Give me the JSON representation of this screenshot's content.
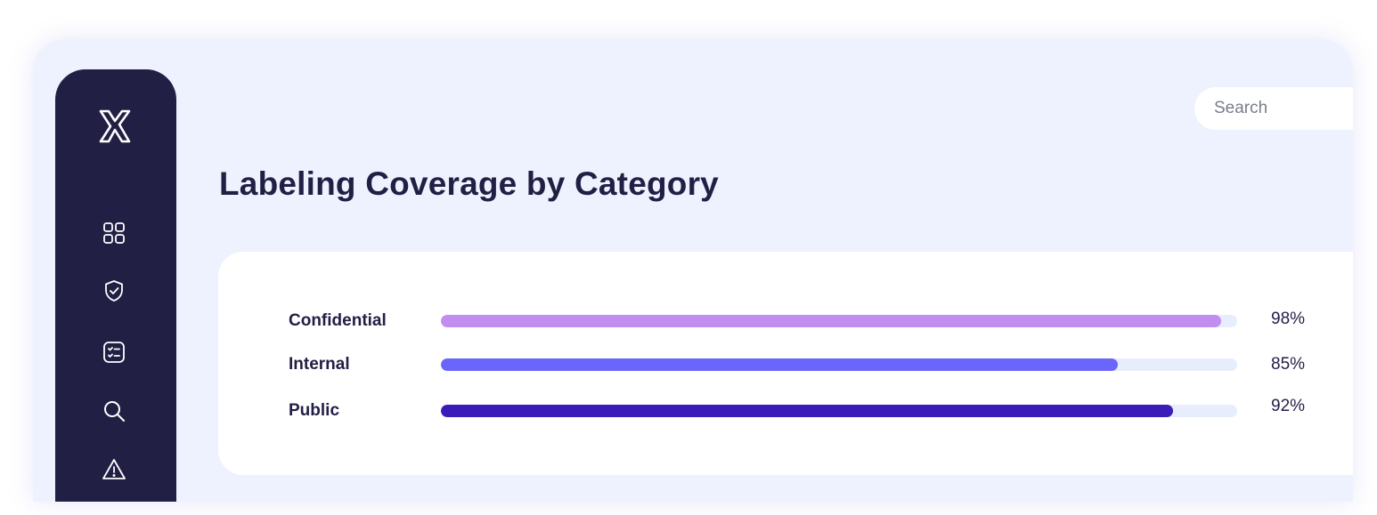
{
  "header": {
    "title": "Labeling Coverage by Category",
    "search": {
      "placeholder": "Search",
      "value": ""
    }
  },
  "sidebar": {
    "logo": "k-logo",
    "items": [
      {
        "icon": "grid-icon"
      },
      {
        "icon": "shield-check-icon"
      },
      {
        "icon": "checklist-icon"
      },
      {
        "icon": "search-icon"
      },
      {
        "icon": "warning-icon"
      }
    ]
  },
  "coverage": {
    "rows": [
      {
        "label": "Confidential",
        "value": 98,
        "value_text": "98%",
        "color": "#c18ef0"
      },
      {
        "label": "Internal",
        "value": 85,
        "value_text": "85%",
        "color": "#6b66fb"
      },
      {
        "label": "Public",
        "value": 92,
        "value_text": "92%",
        "color": "#3b1cb8"
      }
    ]
  },
  "colors": {
    "sidebar": "#221f45",
    "background": "#eef2fe",
    "track": "#e7edfc"
  }
}
